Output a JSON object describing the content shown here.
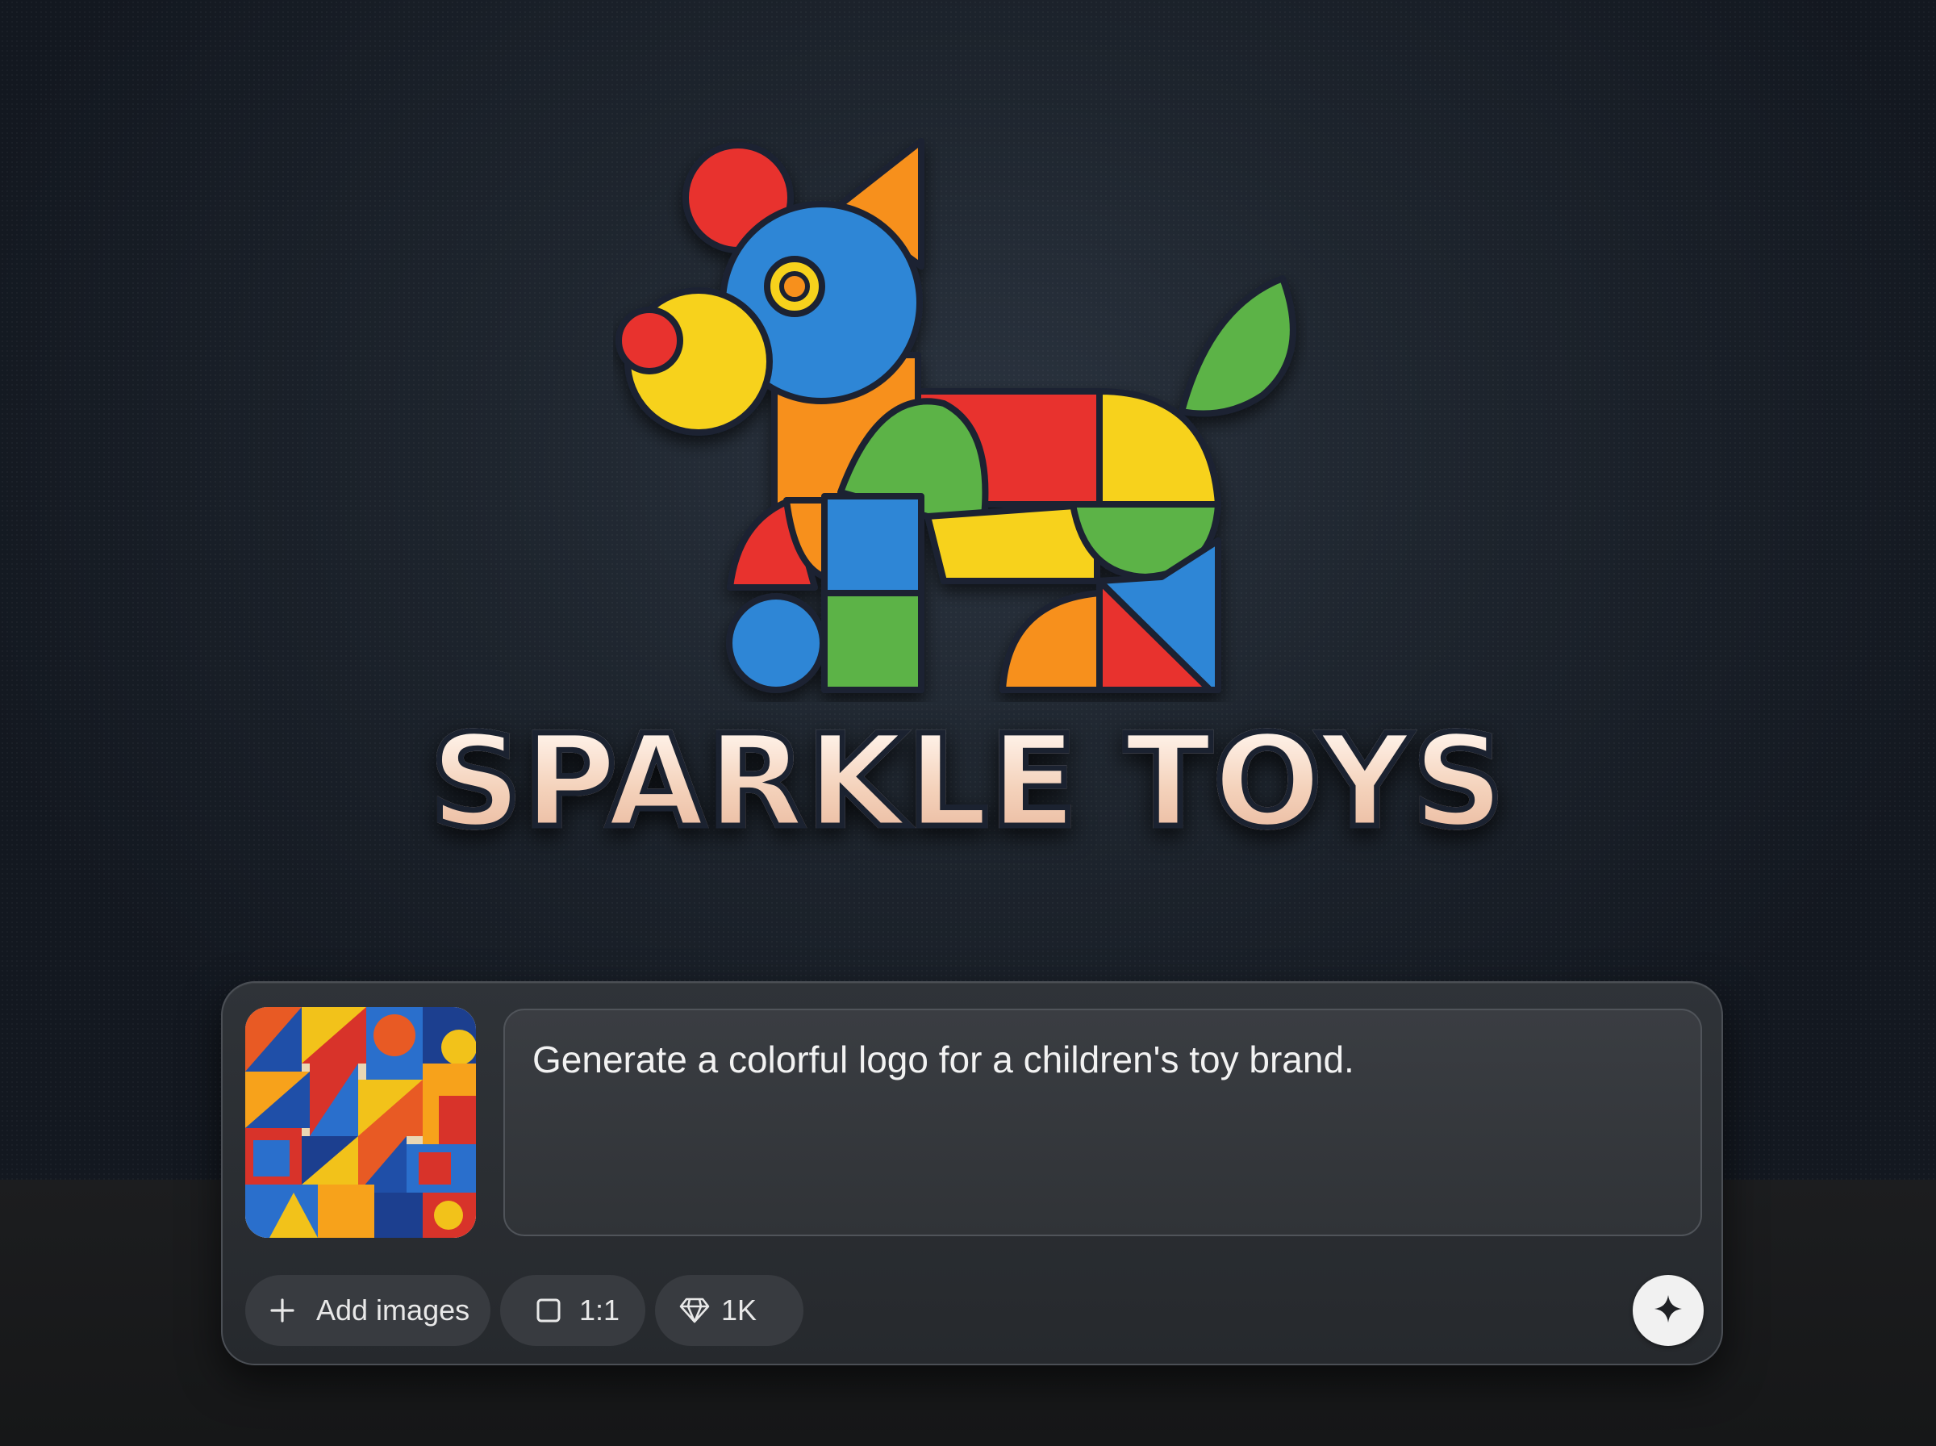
{
  "brand": {
    "name": "SPARKLE TOYS",
    "logo_icon": "geometric-dog-icon"
  },
  "composer": {
    "reference_image": "abstract-geometric-thumbnail",
    "prompt_text": "Generate a colorful logo for a children's toy brand.",
    "add_images": {
      "icon": "plus-icon",
      "label": "Add images"
    },
    "aspect_ratio": {
      "icon": "square-icon",
      "label": "1:1"
    },
    "resolution": {
      "icon": "diamond-icon",
      "label": "1K"
    },
    "generate": {
      "icon": "sparkle-icon"
    }
  },
  "colors": {
    "logo_red": "#e8302f",
    "logo_blue": "#2f86d6",
    "logo_yellow": "#f7d21f",
    "logo_green": "#5bb346",
    "logo_orange": "#f7901e",
    "outline": "#1b2433"
  }
}
